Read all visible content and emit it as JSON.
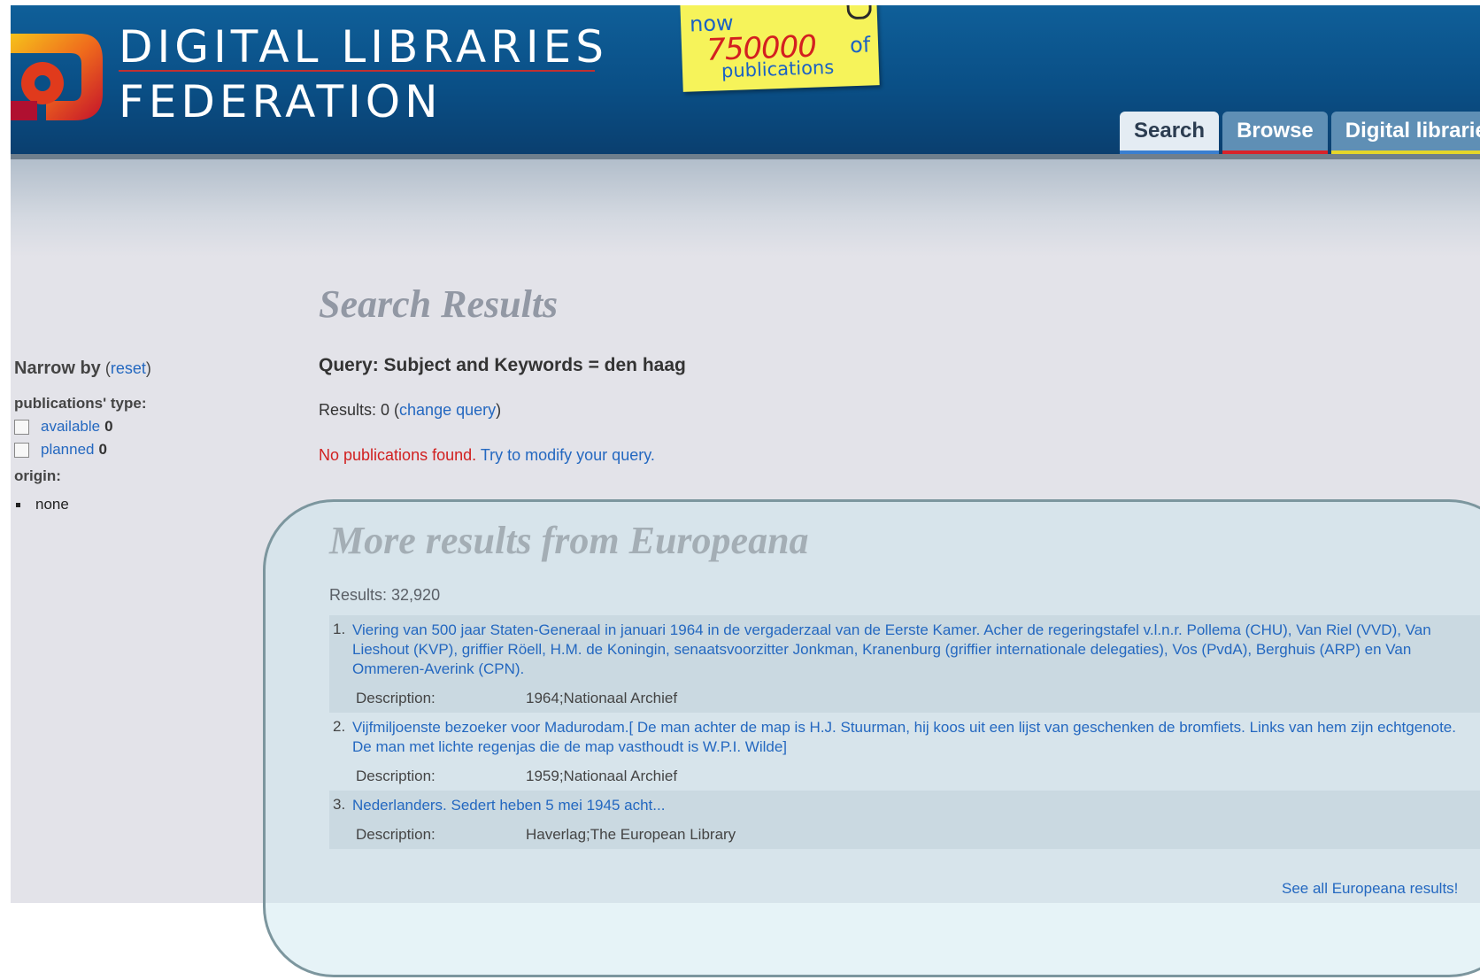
{
  "header": {
    "title_line1": "DIGITAL LIBRARIES",
    "title_line2": "FEDERATION",
    "logo_icon": "dlf-logo-icon",
    "note": {
      "now": "now",
      "count": "750000",
      "of": "of",
      "publications": "publications"
    },
    "tabs": [
      {
        "label": "Search"
      },
      {
        "label": "Browse"
      },
      {
        "label": "Digital librarie"
      }
    ]
  },
  "sidebar": {
    "narrow_by": "Narrow by",
    "reset_open": "(",
    "reset_label": "reset",
    "reset_close": ")",
    "pub_type_label": "publications' type:",
    "options": [
      {
        "label": "available",
        "count": "0"
      },
      {
        "label": "planned",
        "count": "0"
      }
    ],
    "origin_label": "origin:",
    "origin_value": "none"
  },
  "main": {
    "heading": "Search Results",
    "query": "Query: Subject and Keywords = den haag",
    "results_prefix": "Results: 0 (",
    "change_query": "change query",
    "results_suffix": ")",
    "no_results": "No publications found.",
    "modify": "Try to modify your query."
  },
  "europeana": {
    "heading": "More results from Europeana",
    "results": "Results: 32,920",
    "description_label": "Description:",
    "items": [
      {
        "num": "1.",
        "title": "Viering van 500 jaar Staten-Generaal in januari 1964 in de vergaderzaal van de Eerste Kamer. Acher de regeringstafel v.l.n.r. Pollema (CHU), Van Riel (VVD), Van Lieshout (KVP), griffier Röell, H.M. de Koningin, senaatsvoorzitter Jonkman, Kranenburg (griffier internationale delegaties), Vos (PvdA), Berghuis (ARP) en Van Ommeren-Averink (CPN).",
        "description": "1964;Nationaal Archief"
      },
      {
        "num": "2.",
        "title": "Vijfmiljoenste bezoeker voor Madurodam.[ De man achter de map is H.J. Stuurman, hij koos uit een lijst van geschenken de bromfiets. Links van hem zijn echtgenote. De man met lichte regenjas die de map vasthoudt is W.P.I. Wilde]",
        "description": "1959;Nationaal Archief"
      },
      {
        "num": "3.",
        "title": "Nederlanders. Sedert heben 5 mei 1945 acht...",
        "description": "Haverlag;The European Library"
      }
    ],
    "see_all": "See all Europeana results!"
  },
  "colors": {
    "header": "#0a4f86",
    "link": "#2468c0",
    "error": "#d12020",
    "note": "#f6f35a"
  }
}
